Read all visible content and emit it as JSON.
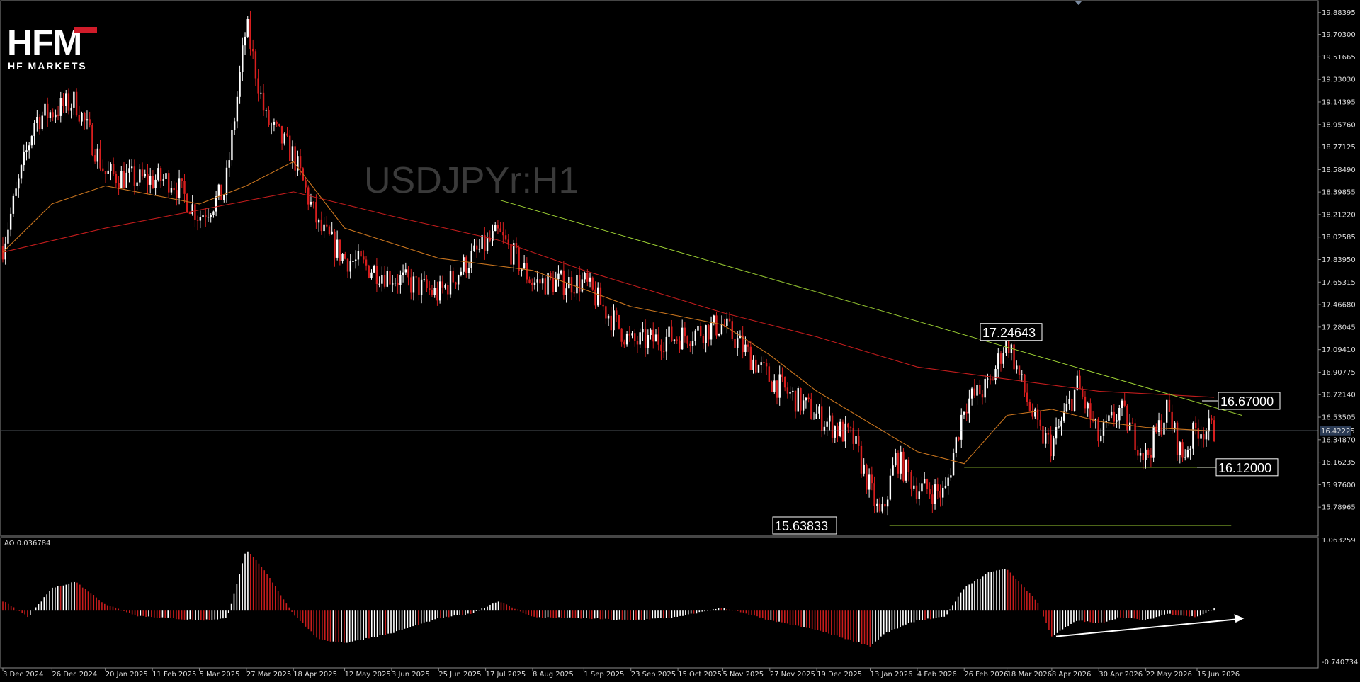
{
  "logo": {
    "mark": "HFM",
    "subtitle": "HF MARKETS"
  },
  "symbol_watermark": "USDJPYr:H1",
  "current_price_label": "16.42225",
  "callouts": {
    "high": "17.24643",
    "resistance": "16.67000",
    "support": "16.12000",
    "low": "15.63833"
  },
  "ao_header": "AO 0.036784",
  "colors": {
    "background": "#000000",
    "bull_candle": "#ffffff",
    "bear_candle": "#d81e1e",
    "ma_fast": "#c8741e",
    "ma_slow": "#c01c1c",
    "trendline": "#9acd32",
    "ao_up": "#ffffff",
    "ao_down": "#c81c1c",
    "divergence_arrow": "#ffffff"
  },
  "chart_data": [
    {
      "type": "candlestick",
      "title": "USDJPYr:H1",
      "y_ticks": [
        "19.88395",
        "19.70300",
        "19.51665",
        "19.33030",
        "19.14395",
        "18.95760",
        "18.77125",
        "18.58490",
        "18.39855",
        "18.21220",
        "18.02585",
        "17.83950",
        "17.65315",
        "17.46680",
        "17.28045",
        "17.09410",
        "16.90775",
        "16.72140",
        "16.53505",
        "16.34870",
        "16.16235",
        "15.97600",
        "15.78965"
      ],
      "ylim": [
        15.65,
        19.9
      ],
      "x_tick_labels": [
        "3 Dec 2024",
        "26 Dec 2024",
        "20 Jan 2025",
        "11 Feb 2025",
        "5 Mar 2025",
        "27 Mar 2025",
        "18 Apr 2025",
        "12 May 2025",
        "3 Jun 2025",
        "25 Jun 2025",
        "17 Jul 2025",
        "8 Aug 2025",
        "1 Sep 2025",
        "23 Sep 2025",
        "15 Oct 2025",
        "5 Nov 2025",
        "27 Nov 2025",
        "19 Dec 2025",
        "13 Jan 2026",
        "4 Feb 2026",
        "26 Feb 2026",
        "18 Mar 2026",
        "8 Apr 2026",
        "30 Apr 2026",
        "22 May 2026",
        "15 Jun 2026"
      ],
      "close_path": [
        [
          "3 Dec 2024",
          17.95
        ],
        [
          "18 Dec 2024",
          19.0
        ],
        [
          "6 Jan 2025",
          19.15
        ],
        [
          "20 Jan 2025",
          18.55
        ],
        [
          "4 Feb 2025",
          18.5
        ],
        [
          "20 Feb 2025",
          18.5
        ],
        [
          "5 Mar 2025",
          18.2
        ],
        [
          "17 Mar 2025",
          18.4
        ],
        [
          "27 Mar 2025",
          19.78
        ],
        [
          "5 Apr 2025",
          19.0
        ],
        [
          "18 Apr 2025",
          18.7
        ],
        [
          "30 Apr 2025",
          18.1
        ],
        [
          "12 May 2025",
          17.85
        ],
        [
          "3 Jun 2025",
          17.7
        ],
        [
          "25 Jun 2025",
          17.55
        ],
        [
          "10 Jul 2025",
          17.85
        ],
        [
          "23 Jul 2025",
          18.05
        ],
        [
          "8 Aug 2025",
          17.65
        ],
        [
          "1 Sep 2025",
          17.65
        ],
        [
          "23 Sep 2025",
          17.15
        ],
        [
          "15 Oct 2025",
          17.2
        ],
        [
          "5 Nov 2025",
          17.3
        ],
        [
          "27 Nov 2025",
          16.85
        ],
        [
          "19 Dec 2025",
          16.55
        ],
        [
          "5 Jan 2026",
          16.35
        ],
        [
          "18 Jan 2026",
          15.68
        ],
        [
          "25 Jan 2026",
          16.2
        ],
        [
          "4 Feb 2026",
          15.95
        ],
        [
          "17 Feb 2026",
          15.9
        ],
        [
          "26 Feb 2026",
          16.65
        ],
        [
          "10 Mar 2026",
          16.8
        ],
        [
          "18 Mar 2026",
          17.2
        ],
        [
          "25 Mar 2026",
          16.8
        ],
        [
          "2 Apr 2026",
          16.4
        ],
        [
          "8 Apr 2026",
          16.3
        ],
        [
          "20 Apr 2026",
          16.8
        ],
        [
          "30 Apr 2026",
          16.35
        ],
        [
          "10 May 2026",
          16.6
        ],
        [
          "22 May 2026",
          16.2
        ],
        [
          "1 Jun 2026",
          16.6
        ],
        [
          "8 Jun 2026",
          16.2
        ],
        [
          "15 Jun 2026",
          16.45
        ],
        [
          "23 Jun 2026",
          16.42
        ]
      ],
      "ma_slow_path": [
        [
          "3 Dec 2024",
          17.9
        ],
        [
          "20 Jan 2025",
          18.1
        ],
        [
          "5 Mar 2025",
          18.25
        ],
        [
          "18 Apr 2025",
          18.4
        ],
        [
          "3 Jun 2025",
          18.2
        ],
        [
          "23 Jul 2025",
          18.0
        ],
        [
          "1 Sep 2025",
          17.75
        ],
        [
          "5 Nov 2025",
          17.4
        ],
        [
          "19 Dec 2025",
          17.2
        ],
        [
          "4 Feb 2026",
          16.95
        ],
        [
          "18 Mar 2026",
          16.85
        ],
        [
          "30 Apr 2026",
          16.75
        ],
        [
          "23 Jun 2026",
          16.7
        ]
      ],
      "ma_fast_path": [
        [
          "3 Dec 2024",
          17.9
        ],
        [
          "26 Dec 2024",
          18.3
        ],
        [
          "20 Jan 2025",
          18.45
        ],
        [
          "5 Mar 2025",
          18.3
        ],
        [
          "27 Mar 2025",
          18.45
        ],
        [
          "18 Apr 2025",
          18.65
        ],
        [
          "12 May 2025",
          18.1
        ],
        [
          "25 Jun 2025",
          17.85
        ],
        [
          "8 Aug 2025",
          17.75
        ],
        [
          "23 Sep 2025",
          17.45
        ],
        [
          "5 Nov 2025",
          17.3
        ],
        [
          "27 Nov 2025",
          17.05
        ],
        [
          "19 Dec 2025",
          16.75
        ],
        [
          "4 Feb 2026",
          16.25
        ],
        [
          "26 Feb 2026",
          16.15
        ],
        [
          "18 Mar 2026",
          16.55
        ],
        [
          "8 Apr 2026",
          16.6
        ],
        [
          "30 Apr 2026",
          16.5
        ],
        [
          "22 May 2026",
          16.45
        ],
        [
          "23 Jun 2026",
          16.42
        ]
      ],
      "trendline": {
        "from": [
          "24 Jul 2025",
          18.33
        ],
        "to": [
          "6 Jul 2026",
          16.55
        ]
      },
      "horizontal_lines": [
        {
          "value": 16.12,
          "from": "26 Feb 2026",
          "to": "1 Jul 2026"
        },
        {
          "value": 15.6383,
          "from": "22 Jan 2026",
          "to": "1 Jul 2026"
        }
      ],
      "current_price": 16.42225
    },
    {
      "type": "bar",
      "title": "AO 0.036784",
      "y_ticks": [
        "1.063259",
        "-0.740734"
      ],
      "ylim": [
        -0.8,
        1.1
      ],
      "series": [
        {
          "name": "AO",
          "path": [
            [
              "3 Dec 2024",
              0.15
            ],
            [
              "15 Dec 2024",
              -0.1
            ],
            [
              "26 Dec 2024",
              0.35
            ],
            [
              "6 Jan 2025",
              0.45
            ],
            [
              "20 Jan 2025",
              0.1
            ],
            [
              "4 Feb 2025",
              -0.08
            ],
            [
              "20 Feb 2025",
              -0.12
            ],
            [
              "5 Mar 2025",
              -0.15
            ],
            [
              "18 Mar 2025",
              -0.12
            ],
            [
              "27 Mar 2025",
              0.95
            ],
            [
              "5 Apr 2025",
              0.6
            ],
            [
              "18 Apr 2025",
              -0.05
            ],
            [
              "30 Apr 2025",
              -0.45
            ],
            [
              "12 May 2025",
              -0.5
            ],
            [
              "3 Jun 2025",
              -0.35
            ],
            [
              "25 Jun 2025",
              -0.12
            ],
            [
              "10 Jul 2025",
              -0.05
            ],
            [
              "23 Jul 2025",
              0.15
            ],
            [
              "8 Aug 2025",
              -0.1
            ],
            [
              "1 Sep 2025",
              -0.12
            ],
            [
              "23 Sep 2025",
              -0.15
            ],
            [
              "15 Oct 2025",
              -0.1
            ],
            [
              "5 Nov 2025",
              0.05
            ],
            [
              "27 Nov 2025",
              -0.15
            ],
            [
              "19 Dec 2025",
              -0.3
            ],
            [
              "13 Jan 2026",
              -0.55
            ],
            [
              "20 Jan 2026",
              -0.35
            ],
            [
              "4 Feb 2026",
              -0.15
            ],
            [
              "17 Feb 2026",
              -0.1
            ],
            [
              "26 Feb 2026",
              0.35
            ],
            [
              "10 Mar 2026",
              0.6
            ],
            [
              "18 Mar 2026",
              0.65
            ],
            [
              "1 Apr 2026",
              0.15
            ],
            [
              "8 Apr 2026",
              -0.4
            ],
            [
              "20 Apr 2026",
              -0.15
            ],
            [
              "30 Apr 2026",
              -0.2
            ],
            [
              "10 May 2026",
              -0.1
            ],
            [
              "22 May 2026",
              -0.15
            ],
            [
              "1 Jun 2026",
              -0.05
            ],
            [
              "15 Jun 2026",
              -0.1
            ],
            [
              "23 Jun 2026",
              0.036784
            ]
          ]
        }
      ],
      "annotation": {
        "type": "arrow",
        "from": [
          "10 Apr 2026",
          -0.4
        ],
        "to": [
          "7 Jul 2026",
          -0.12
        ]
      }
    }
  ]
}
